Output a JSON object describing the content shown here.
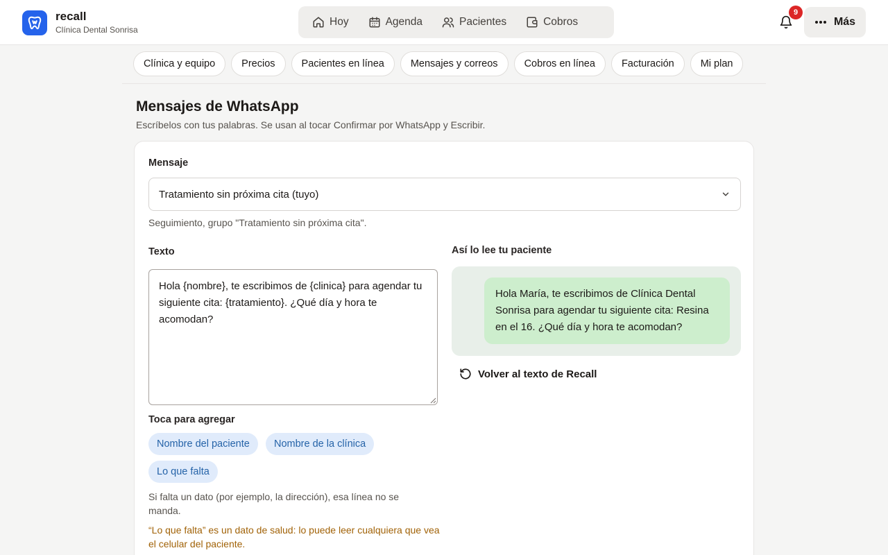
{
  "brand": {
    "name": "recall",
    "clinic": "Clínica Dental Sonrisa"
  },
  "nav": [
    {
      "label": "Hoy",
      "icon": "home-icon"
    },
    {
      "label": "Agenda",
      "icon": "calendar-icon"
    },
    {
      "label": "Pacientes",
      "icon": "users-icon"
    },
    {
      "label": "Cobros",
      "icon": "wallet-icon"
    }
  ],
  "notifications": {
    "count": "9"
  },
  "more": {
    "label": "Más"
  },
  "tabs": [
    "Clínica y equipo",
    "Precios",
    "Pacientes en línea",
    "Mensajes y correos",
    "Cobros en línea",
    "Facturación",
    "Mi plan"
  ],
  "page": {
    "title": "Mensajes de WhatsApp",
    "subtitle": "Escríbelos con tus palabras. Se usan al tocar Confirmar por WhatsApp y Escribir."
  },
  "form": {
    "message_label": "Mensaje",
    "message_selected": "Tratamiento sin próxima cita (tuyo)",
    "message_hint": "Seguimiento, grupo \"Tratamiento sin próxima cita\".",
    "text_label": "Texto",
    "text_value": "Hola {nombre}, te escribimos de {clinica} para agendar tu siguiente cita: {tratamiento}. ¿Qué día y hora te acomodan?",
    "add_label": "Toca para agregar",
    "chips": [
      "Nombre del paciente",
      "Nombre de la clínica",
      "Lo que falta"
    ],
    "missing_note": "Si falta un dato (por ejemplo, la dirección), esa línea no se manda.",
    "health_warning": "“Lo que falta” es un dato de salud: lo puede leer cualquiera que vea el celular del paciente."
  },
  "preview": {
    "label": "Así lo lee tu paciente",
    "text": "Hola María, te escribimos de Clínica Dental Sonrisa para agendar tu siguiente cita: Resina en el 16. ¿Qué día y hora te acomodan?",
    "reset_label": "Volver al texto de Recall"
  },
  "colors": {
    "accent": "#2563eb",
    "badge": "#dc2626",
    "bubble": "#cdeecd",
    "chip": "#e0ebfb",
    "warning": "#a16207"
  }
}
